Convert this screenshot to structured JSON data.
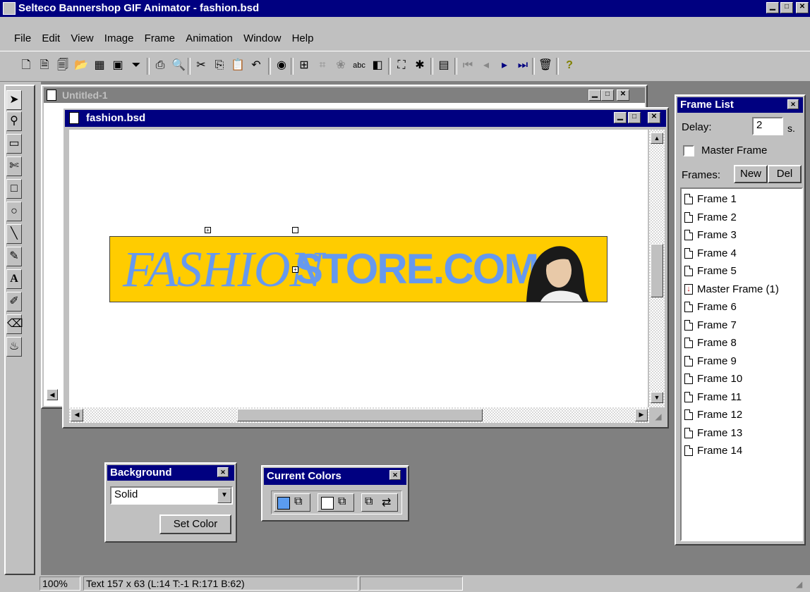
{
  "app": {
    "title": "Selteco Bannershop GIF Animator - fashion.bsd"
  },
  "menu": [
    "File",
    "Edit",
    "View",
    "Image",
    "Frame",
    "Animation",
    "Window",
    "Help"
  ],
  "toolbar": {
    "icons": [
      "new-icon",
      "open-icon",
      "open-animation-icon",
      "import-icon",
      "wizard-icon",
      "save-icon",
      "optimize-icon",
      "print-icon",
      "print-preview-icon",
      "cut-icon",
      "copy-icon",
      "paste-icon",
      "undo-icon",
      "preview-icon",
      "resize-icon",
      "crop-icon",
      "effects-icon",
      "text-icon",
      "transition-icon",
      "add-frame-icon",
      "new-frame-icon",
      "banner-icon",
      "first-frame-icon",
      "prev-frame-icon",
      "next-frame-icon",
      "last-frame-icon",
      "delete-icon",
      "help-icon"
    ]
  },
  "tools": {
    "icons": [
      "arrow-icon",
      "zoom-icon",
      "rect-select-icon",
      "lasso-icon",
      "rectangle-icon",
      "ellipse-icon",
      "line-icon",
      "pencil-icon",
      "text-icon",
      "eyedropper-icon",
      "eraser-icon",
      "fill-icon"
    ],
    "text_glyph": "A"
  },
  "windows": {
    "untitled": {
      "title": "Untitled-1"
    },
    "fashion": {
      "title": "fashion.bsd"
    }
  },
  "banner": {
    "part1": "FASHION",
    "part2": "STORE.COM",
    "bg_color": "#ffcc00",
    "text_color": "#6699ee"
  },
  "frame_list": {
    "title": "Frame List",
    "delay_label": "Delay:",
    "delay_value": "2",
    "delay_unit": "s.",
    "master_frame_label": "Master Frame",
    "master_frame_checked": false,
    "frames_label": "Frames:",
    "new_label": "New",
    "del_label": "Del",
    "items": [
      "Frame 1",
      "Frame 2",
      "Frame 3",
      "Frame 4",
      "Frame 5",
      "Master Frame (1)",
      "Frame 6",
      "Frame 7",
      "Frame 8",
      "Frame 9",
      "Frame 10",
      "Frame 11",
      "Frame 12",
      "Frame 13",
      "Frame 14"
    ]
  },
  "background_panel": {
    "title": "Background",
    "select_value": "Solid",
    "set_color_label": "Set Color"
  },
  "colors_panel": {
    "title": "Current Colors",
    "primary_color": "#5b9cf0"
  },
  "status": {
    "zoom": "100%",
    "info": "Text 157 x 63 (L:14  T:-1  R:171  B:62)"
  }
}
